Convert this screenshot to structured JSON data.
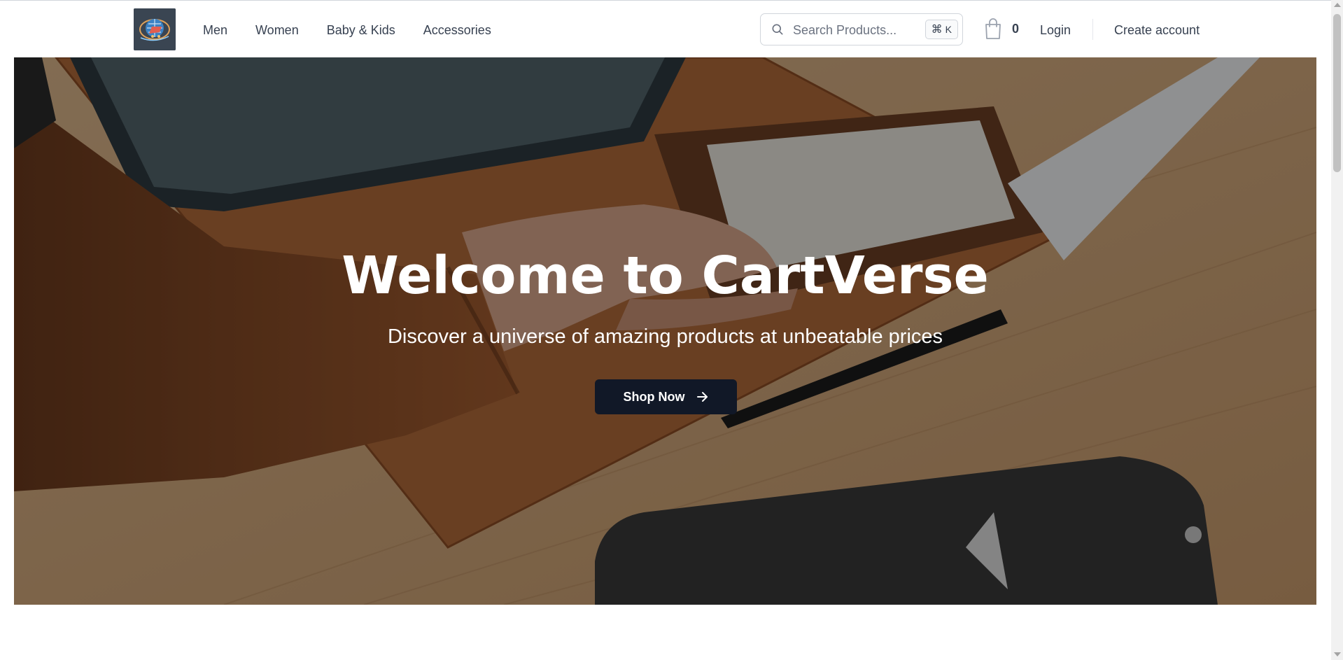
{
  "header": {
    "nav": [
      {
        "label": "Men"
      },
      {
        "label": "Women"
      },
      {
        "label": "Baby & Kids"
      },
      {
        "label": "Accessories"
      }
    ],
    "search": {
      "placeholder": "Search Products...",
      "shortcut_symbol": "⌘",
      "shortcut_key": "K"
    },
    "cart": {
      "count": "0"
    },
    "login_label": "Login",
    "create_account_label": "Create account"
  },
  "hero": {
    "title": "Welcome to CartVerse",
    "subtitle": "Discover a universe of amazing products at unbeatable prices",
    "cta_label": "Shop Now"
  },
  "icons": {
    "logo": "globe-cart-logo",
    "search": "search-icon",
    "cart": "shopping-bag-icon",
    "cta": "arrow-right-icon"
  },
  "colors": {
    "cta_background": "#111827",
    "text_primary": "#374151",
    "hero_overlay": "rgba(0,0,0,0.40)"
  }
}
